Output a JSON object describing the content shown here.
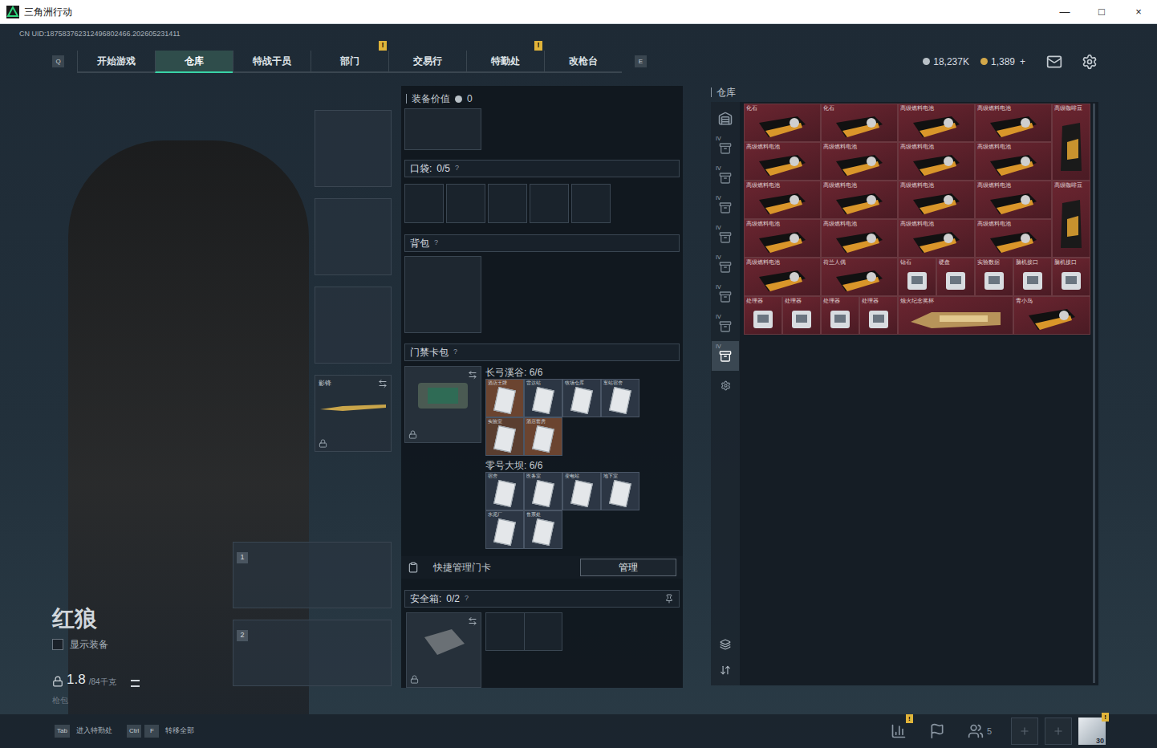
{
  "window": {
    "title": "三角洲行动",
    "controls": [
      "—",
      "□",
      "×"
    ]
  },
  "uid": "CN UID:187583762312496802466.202605231411",
  "nav": {
    "prev_key": "Q",
    "next_key": "E",
    "alert_badge": "!",
    "tabs": [
      {
        "label": "开始游戏",
        "selected": false,
        "alert": false
      },
      {
        "label": "仓库",
        "selected": true,
        "alert": false
      },
      {
        "label": "特战干员",
        "selected": false,
        "alert": false
      },
      {
        "label": "部门",
        "selected": false,
        "alert": true
      },
      {
        "label": "交易行",
        "selected": false,
        "alert": false
      },
      {
        "label": "特勤处",
        "selected": false,
        "alert": true
      },
      {
        "label": "改枪台",
        "selected": false,
        "alert": false
      }
    ]
  },
  "currency": [
    {
      "amount": "18,237K",
      "kind": "coin"
    },
    {
      "amount": "1,389",
      "kind": "bond"
    }
  ],
  "currency_add": "+",
  "operator": {
    "name": "红狼",
    "show_equipment": {
      "label": "显示装备",
      "checked": false
    },
    "weight": "1.8",
    "weight_max": "/84千克",
    "loadout_label": "枪包"
  },
  "equipment": {
    "melee": {
      "name": "影锋",
      "locked": true
    },
    "weapon_slots": [
      "1",
      "2"
    ]
  },
  "loadout": {
    "value_label": "装备价值",
    "value": "0",
    "pockets": {
      "label": "口袋:",
      "count": "0/5",
      "help": "?",
      "slots": [
        false,
        false,
        false,
        false,
        false
      ]
    },
    "backpack": {
      "label": "背包",
      "help": "?"
    },
    "keycards": {
      "label": "门禁卡包",
      "help": "?",
      "locked": true,
      "maps": [
        {
          "name": "长弓溪谷: 6/6",
          "cards": [
            {
              "name": "酒店王牌",
              "color": "#6b4430"
            },
            {
              "name": "雷达站",
              "color": "#2c3644"
            },
            {
              "name": "牧场仓库",
              "color": "#2c3644"
            },
            {
              "name": "车站宿舍",
              "color": "#2c3644"
            },
            {
              "name": "实验室",
              "color": "#5a3e30"
            },
            {
              "name": "酒店套房",
              "color": "#6b4430"
            }
          ]
        },
        {
          "name": "零号大坝: 6/6",
          "cards": [
            {
              "name": "宿舍",
              "color": "#2c3644"
            },
            {
              "name": "医务室",
              "color": "#2c3644"
            },
            {
              "name": "变电站",
              "color": "#2c3644"
            },
            {
              "name": "地下室",
              "color": "#2c3644"
            },
            {
              "name": "水泥厂",
              "color": "#2c3644"
            },
            {
              "name": "售票处",
              "color": "#2c3644"
            }
          ]
        }
      ]
    },
    "quick_manage": {
      "label": "快捷管理门卡",
      "button": "管理"
    },
    "safe_box": {
      "label": "安全箱:",
      "count": "0/2",
      "help": "?",
      "locked": true
    }
  },
  "warehouse": {
    "title": "仓库",
    "tabs": [
      {
        "label": "",
        "kind": "home",
        "selected": false
      },
      {
        "label": "IV",
        "kind": "level",
        "selected": false
      },
      {
        "label": "IV",
        "kind": "level",
        "selected": false
      },
      {
        "label": "IV",
        "kind": "level",
        "selected": false
      },
      {
        "label": "IV",
        "kind": "level",
        "selected": false
      },
      {
        "label": "IV",
        "kind": "level",
        "selected": false
      },
      {
        "label": "IV",
        "kind": "level",
        "selected": false
      },
      {
        "label": "IV",
        "kind": "level",
        "selected": false
      },
      {
        "label": "IV",
        "kind": "level",
        "selected": true
      },
      {
        "label": "",
        "kind": "settings",
        "selected": false
      }
    ],
    "items": [
      {
        "name": "化石",
        "kind": "wide"
      },
      {
        "name": "化石",
        "kind": "wide"
      },
      {
        "name": "高级燃料电池",
        "kind": "wide"
      },
      {
        "name": "高级燃料电池",
        "kind": "wide"
      },
      {
        "name": "高级咖啡豆",
        "kind": "tall"
      },
      {
        "name": "高级燃料电池",
        "kind": "wide"
      },
      {
        "name": "高级燃料电池",
        "kind": "wide"
      },
      {
        "name": "高级燃料电池",
        "kind": "wide"
      },
      {
        "name": "高级燃料电池",
        "kind": "wide"
      },
      {
        "name": "高级燃料电池",
        "kind": "wide"
      },
      {
        "name": "高级燃料电池",
        "kind": "wide"
      },
      {
        "name": "高级燃料电池",
        "kind": "wide"
      },
      {
        "name": "高级燃料电池",
        "kind": "wide"
      },
      {
        "name": "高级咖啡豆",
        "kind": "tall"
      },
      {
        "name": "高级燃料电池",
        "kind": "wide"
      },
      {
        "name": "高级燃料电池",
        "kind": "wide"
      },
      {
        "name": "高级燃料电池",
        "kind": "wide"
      },
      {
        "name": "高级燃料电池",
        "kind": "wide"
      },
      {
        "name": "高级燃料电池",
        "kind": "wide"
      },
      {
        "name": "荷兰人偶",
        "kind": "wide"
      },
      {
        "name": "钻石",
        "kind": "small"
      },
      {
        "name": "硬盘",
        "kind": "small"
      },
      {
        "name": "实验数据",
        "kind": "small"
      },
      {
        "name": "脑机接口",
        "kind": "small"
      },
      {
        "name": "脑机接口",
        "kind": "small"
      },
      {
        "name": "处理器",
        "kind": "small"
      },
      {
        "name": "处理器",
        "kind": "small"
      },
      {
        "name": "处理器",
        "kind": "small"
      },
      {
        "name": "处理器",
        "kind": "small"
      },
      {
        "name": "烛火纪念奖杯",
        "kind": "long"
      },
      {
        "name": "青小鸟",
        "kind": "wide"
      }
    ]
  },
  "bottom": {
    "hints": [
      {
        "keys": [
          "Tab"
        ],
        "label": "进入特勤处"
      },
      {
        "keys": [
          "Ctrl",
          "F"
        ],
        "label": "转移全部"
      }
    ],
    "friends": "5",
    "level": "30",
    "alert_badge": "!"
  }
}
